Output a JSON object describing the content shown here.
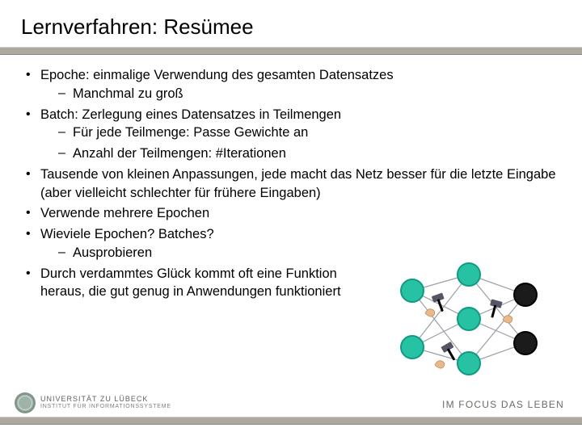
{
  "title": "Lernverfahren: Resümee",
  "bullets": [
    {
      "text": "Epoche: einmalige Verwendung des gesamten Datensatzes",
      "sub": [
        "Manchmal zu groß"
      ]
    },
    {
      "text": "Batch: Zerlegung eines Datensatzes in Teilmengen",
      "sub": [
        "Für jede Teilmenge: Passe Gewichte an",
        "Anzahl der Teilmengen: #Iterationen"
      ]
    },
    {
      "text": "Tausende von kleinen Anpassungen, jede macht das Netz besser für die letzte Eingabe (aber vielleicht schlechter für frühere Eingaben)"
    },
    {
      "text": "Verwende mehrere Epochen"
    },
    {
      "text": "Wieviele Epochen? Batches?",
      "sub": [
        "Ausprobieren"
      ]
    },
    {
      "text": "Durch verdammtes Glück kommt oft eine Funktion heraus, die gut genug in Anwendungen funktioniert"
    }
  ],
  "footer": {
    "university_line1": "UNIVERSITÄT ZU LÜBECK",
    "university_line2": "INSTITUT FÜR INFORMATIONSSYSTEME",
    "slogan": "IM FOCUS DAS LEBEN"
  },
  "illustration": {
    "name": "neural-network-hammer-hands",
    "layers": {
      "input": 2,
      "hidden": 3,
      "output": 2
    }
  }
}
